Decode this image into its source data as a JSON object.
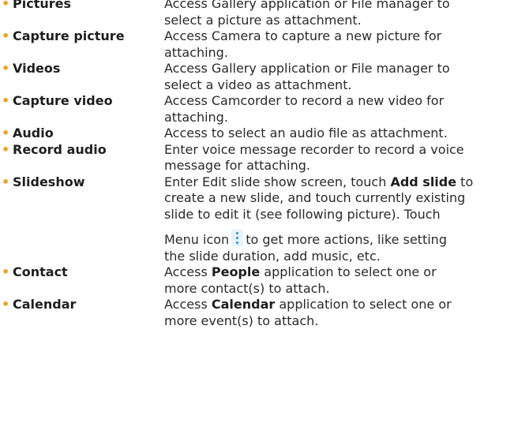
{
  "colors": {
    "bullet": "#f0a41e",
    "menu_icon_dots": "#1e90c8"
  },
  "bullet_glyph": "•",
  "items": [
    {
      "term": "Pictures",
      "lines": [
        "Access Gallery application or File manager to",
        "select a picture as attachment."
      ]
    },
    {
      "term": "Capture picture",
      "lines": [
        "Access Camera to capture a new picture for",
        "attaching."
      ]
    },
    {
      "term": "Videos",
      "lines": [
        "Access Gallery application or File manager to",
        "select a video as attachment."
      ]
    },
    {
      "term": "Capture video",
      "lines": [
        "Access Camcorder to record a new video for",
        "attaching."
      ]
    },
    {
      "term": "Audio",
      "lines": [
        "Access to select an audio file as attachment."
      ]
    },
    {
      "term": "Record audio",
      "lines": [
        "Enter voice message recorder to record a voice",
        "message for attaching."
      ]
    },
    {
      "term": "Slideshow",
      "line1_a": "Enter Edit slide show screen, touch ",
      "line1_bold": "Add slide",
      "line1_b": " to",
      "line2": "create a new slide, and touch currently existing",
      "line3": "slide to edit it (see following picture). Touch",
      "line4_a": "Menu icon",
      "menu_icon": "menu-icon",
      "line4_b": "to get more actions, like setting",
      "line5": "the slide duration, add music, etc."
    },
    {
      "term": "Contact",
      "line1_a": "Access ",
      "line1_bold": "People",
      "line1_b": " application to select one or",
      "line2": "more contact(s) to attach."
    },
    {
      "term": "Calendar",
      "line1_a": "Access ",
      "line1_bold": "Calendar",
      "line1_b": " application to select one or",
      "line2": "more event(s) to attach."
    }
  ]
}
